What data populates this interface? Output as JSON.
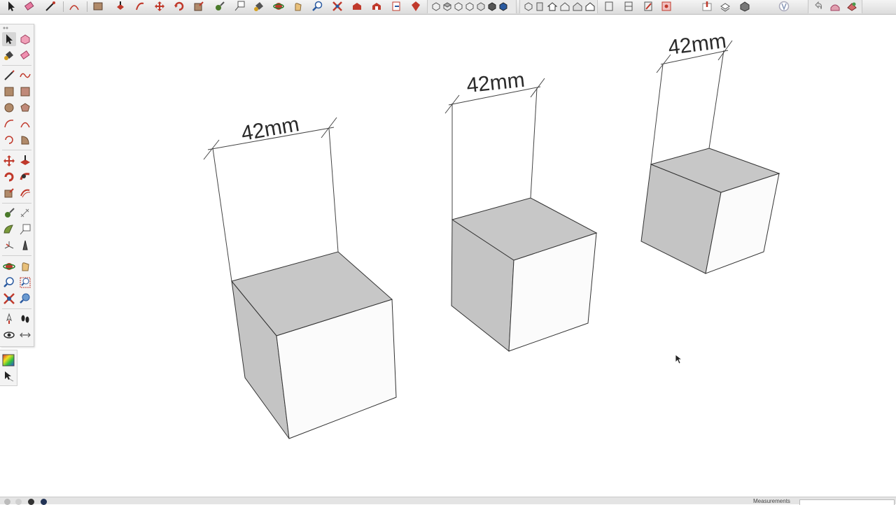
{
  "top_toolbar": {
    "tools": [
      "select-tool",
      "eraser-tool",
      "line-tool",
      "arc-tool",
      "rectangle-tool",
      "push-pull-tool",
      "follow-me-tool",
      "move-tool",
      "rotate-tool",
      "scale-tool",
      "tape-measure-tool",
      "text-tool",
      "paint-bucket-tool",
      "orbit-tool",
      "pan-tool",
      "zoom-tool",
      "zoom-extents-tool",
      "warehouse-tool",
      "extension-warehouse-tool",
      "send-to-layout-tool",
      "extension-manager-tool"
    ],
    "views": [
      "iso-view",
      "top-view",
      "front-view",
      "right-view",
      "back-view",
      "left-view",
      "xray-style",
      "back-edges-style"
    ]
  },
  "tool_palette": {
    "tools": [
      "select-tool",
      "make-component-tool",
      "paint-bucket-tool",
      "eraser-tool",
      "line-tool",
      "freehand-tool",
      "rectangle-tool",
      "rotated-rectangle-tool",
      "circle-tool",
      "polygon-tool",
      "arc-tool",
      "pie-tool",
      "two-point-arc-tool",
      "three-point-arc-tool",
      "move-tool",
      "push-pull-tool",
      "rotate-tool",
      "follow-me-tool",
      "scale-tool",
      "offset-tool",
      "tape-measure-tool",
      "dimension-tool",
      "protractor-tool",
      "text-tool",
      "axes-tool",
      "3d-text-tool",
      "orbit-tool",
      "pan-tool",
      "zoom-tool",
      "zoom-window-tool",
      "zoom-extents-tool",
      "previous-view-tool",
      "position-camera-tool",
      "walk-tool",
      "look-around-tool",
      "section-plane-tool"
    ],
    "extra_tools": [
      "styles-tool",
      "advanced-camera-tool"
    ]
  },
  "model": {
    "dimensions": [
      {
        "label": "42mm"
      },
      {
        "label": "42mm"
      },
      {
        "label": "42mm"
      }
    ],
    "colors": {
      "top_face": "#c7c7c7",
      "left_face": "#c4c4c4",
      "front_face": "#fbfbfb",
      "edge": "#333333",
      "dim_line": "#555555"
    }
  },
  "status_bar": {
    "measurements_label": "Measurements",
    "measurements_value": ""
  }
}
